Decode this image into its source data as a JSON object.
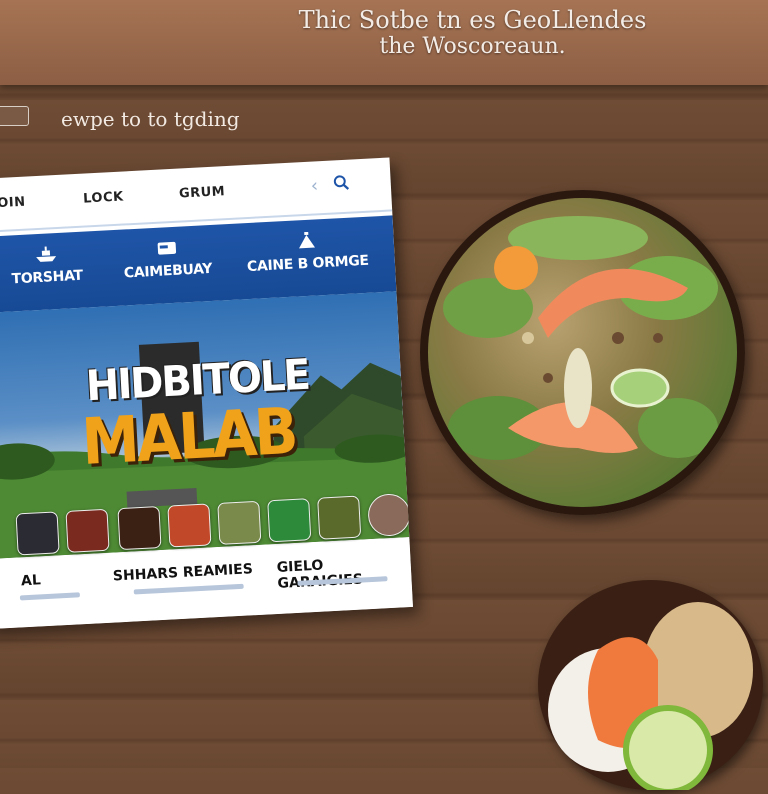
{
  "banner": {
    "line1": "Thic Sotbe tn es GeoLlendes",
    "line2": "the Woscoreaun."
  },
  "swipe": {
    "label": "ewpe to to tgding"
  },
  "tablet": {
    "nav": [
      "OIN",
      "LOCK",
      "GRUM"
    ],
    "categories": [
      {
        "label": "TORSHAT",
        "icon": "ship-icon"
      },
      {
        "label": "CAIMEBUAY",
        "icon": "card-icon"
      },
      {
        "label": "CAINE B ORMGE",
        "icon": "pyramid-icon"
      }
    ],
    "hero": {
      "title_top": "HIDBITOLE",
      "title_bottom": "MALAB"
    },
    "bottom": {
      "col1": "AL",
      "col2": "SHHARS REAMIES",
      "col3": "GIELO GARAIGIES"
    }
  },
  "colors": {
    "banner_bg": "#a67454",
    "nav_blue": "#1f55a8",
    "title_orange": "#f0a21b",
    "wood": "#6a4832"
  }
}
